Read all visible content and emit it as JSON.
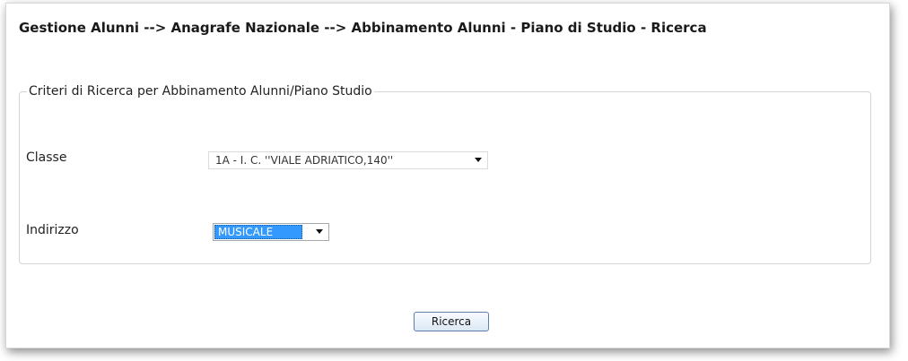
{
  "header": {
    "title": "Gestione Alunni --> Anagrafe Nazionale --> Abbinamento Alunni - Piano di Studio - Ricerca"
  },
  "search_form": {
    "legend": "Criteri di Ricerca per Abbinamento Alunni/Piano Studio",
    "classe": {
      "label": "Classe",
      "value": "1A - I. C. ''VIALE ADRIATICO,140''"
    },
    "indirizzo": {
      "label": "Indirizzo",
      "value": "MUSICALE"
    }
  },
  "actions": {
    "search_label": "Ricerca"
  },
  "icons": {
    "select_arrow": "chevron-down-icon"
  },
  "colors": {
    "selection_highlight": "#3399ff",
    "button_border": "#5f7fa8"
  }
}
